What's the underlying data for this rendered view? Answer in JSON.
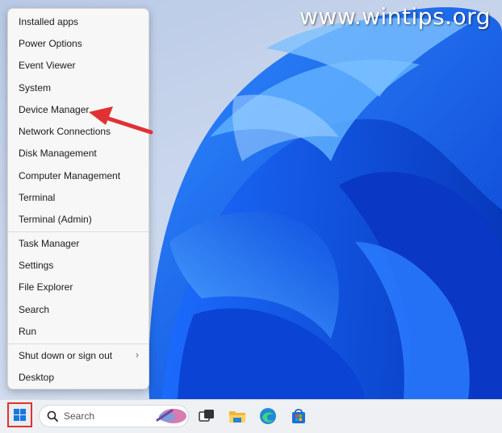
{
  "watermark": "www.wintips.org",
  "menu": {
    "groups": [
      [
        "Installed apps",
        "Power Options",
        "Event Viewer",
        "System",
        "Device Manager",
        "Network Connections",
        "Disk Management",
        "Computer Management",
        "Terminal",
        "Terminal (Admin)"
      ],
      [
        "Task Manager",
        "Settings",
        "File Explorer",
        "Search",
        "Run"
      ],
      [
        "Shut down or sign out",
        "Desktop"
      ]
    ],
    "submenu_chevron": "›"
  },
  "taskbar": {
    "search_label": "Search",
    "icons": [
      "windows-start-icon",
      "search-icon",
      "task-view-icon",
      "file-explorer-icon",
      "edge-browser-icon",
      "microsoft-store-icon"
    ]
  },
  "colors": {
    "annotation_red": "#e03232",
    "accent_blue": "#1877e0"
  }
}
